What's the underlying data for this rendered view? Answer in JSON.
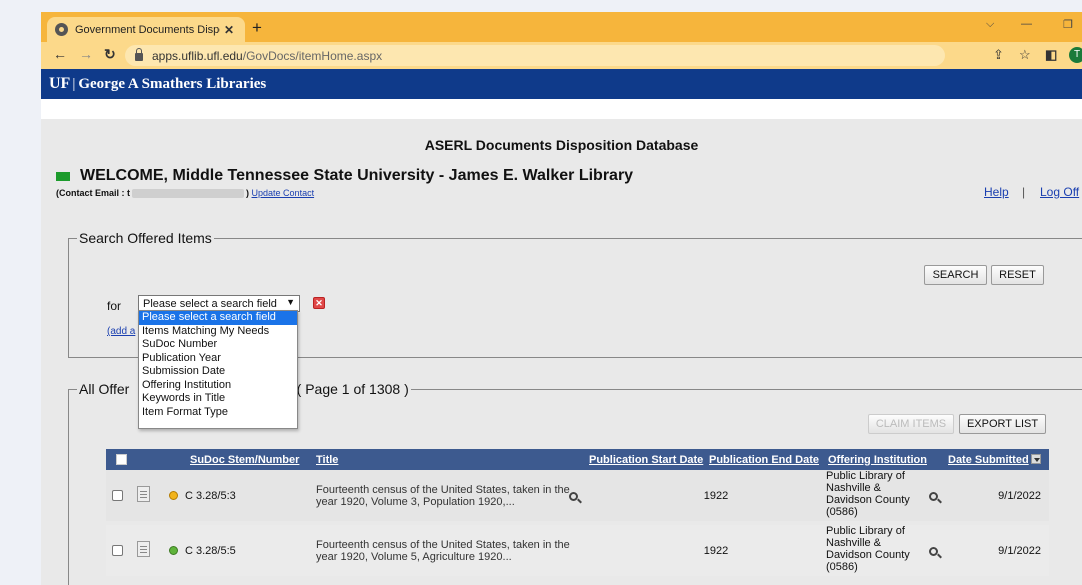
{
  "browser": {
    "tab_title": "Government Documents Disposi",
    "new_tab": "+",
    "url_host": "apps.uflib.ufl.edu",
    "url_path": "/GovDocs/itemHome.aspx",
    "profile_initial": "T"
  },
  "header": {
    "logo": "UF",
    "separator": "|",
    "library_name": "George A Smathers Libraries"
  },
  "page": {
    "db_title": "ASERL Documents Disposition Database",
    "welcome": "WELCOME, Middle Tennessee State University - James E. Walker Library",
    "contact_prefix": "(Contact Email : t",
    "contact_suffix": ")",
    "update_contact": "Update Contact",
    "help": "Help",
    "separator": "|",
    "logoff": "Log Off"
  },
  "search": {
    "legend": "Search Offered Items",
    "search_button": "SEARCH",
    "reset_button": "RESET",
    "for_label": "for",
    "selected": "Please select a search field",
    "add_link": "(add a",
    "options": [
      "Please select a search field",
      "Items Matching My Needs",
      "SuDoc Number",
      "Publication Year",
      "Submission Date",
      "Offering Institution",
      "Keywords in Title",
      "Item Format Type"
    ]
  },
  "results": {
    "legend_prefix": "All Offer",
    "legend_suffix": "rch ( Page 1 of 1308 )",
    "claim_button": "CLAIM ITEMS",
    "export_button": "EXPORT LIST",
    "columns": {
      "sudoc": "SuDoc Stem/Number",
      "title": "Title",
      "pub_start": "Publication Start Date",
      "pub_end": "Publication End Date",
      "institution": "Offering Institution",
      "date_submitted": "Date Submitted"
    },
    "rows": [
      {
        "status": "orange",
        "sudoc": "C 3.28/5:3",
        "title": "Fourteenth census of the United States, taken in the year 1920, Volume 3, Population 1920,...",
        "pub_start": "1922",
        "institution": "Public Library of Nashville & Davidson County (0586)",
        "date": "9/1/2022"
      },
      {
        "status": "green",
        "sudoc": "C 3.28/5:5",
        "title": "Fourteenth census of the United States, taken in the year 1920, Volume 5, Agriculture 1920...",
        "pub_start": "1922",
        "institution": "Public Library of Nashville & Davidson County (0586)",
        "date": "9/1/2022"
      }
    ]
  },
  "colors": {
    "tab_strip": "#f6b53c",
    "toolbar": "#fcd98a",
    "uf_blue": "#0f3a8a",
    "table_header": "#3d5a8f",
    "welcome_green": "#1c9b2c"
  },
  "icons": {
    "back": "arrow-left-icon",
    "forward": "arrow-right-icon",
    "reload": "reload-icon",
    "lock": "lock-icon",
    "share": "share-icon",
    "bookmark": "star-icon",
    "sidepanel": "side-panel-icon",
    "search": "magnifier-icon",
    "document": "document-icon",
    "remove": "remove-x-icon"
  }
}
